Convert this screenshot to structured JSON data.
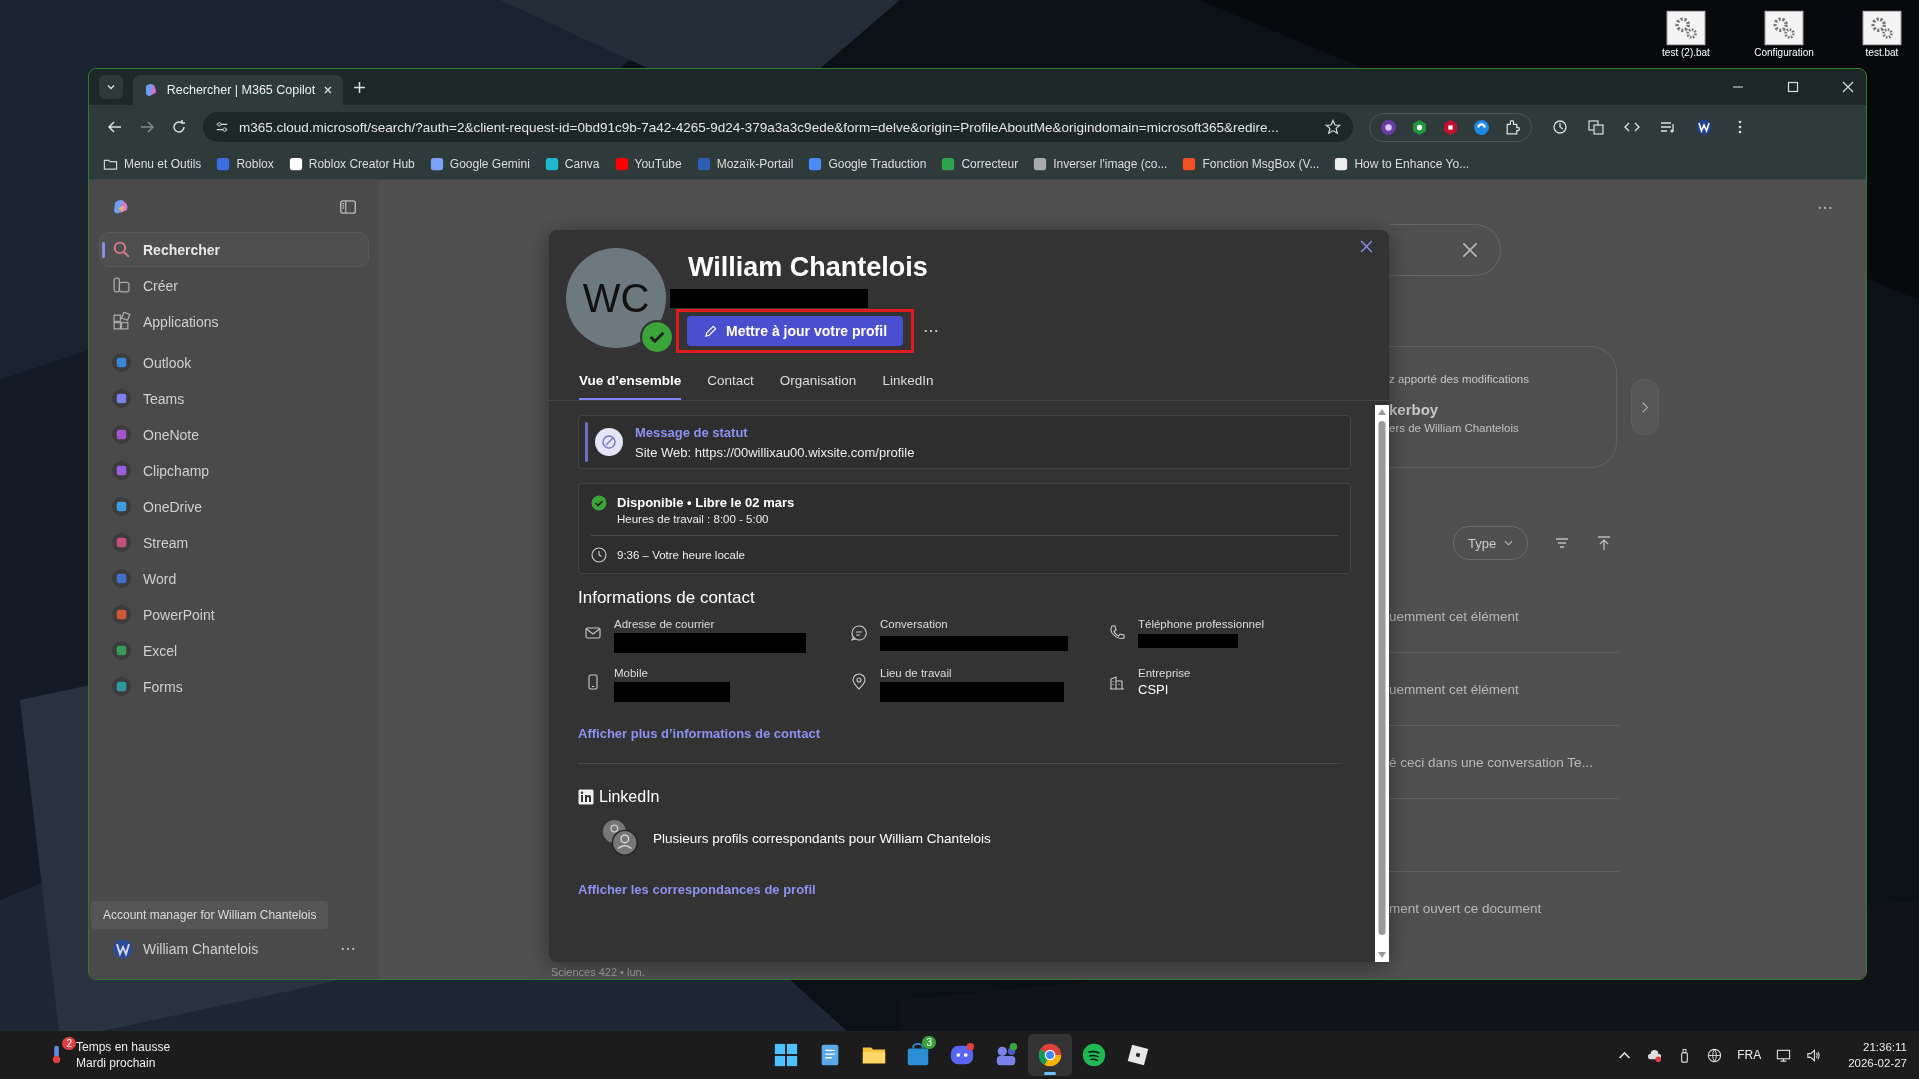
{
  "desktop_icons": [
    {
      "label": "test (2).bat"
    },
    {
      "label": "Configuration"
    },
    {
      "label": "test.bat"
    }
  ],
  "browser": {
    "tabs": [
      {
        "title": "Rechercher | M365 Copilot",
        "selected": true
      }
    ],
    "address": "m365.cloud.microsoft/search/?auth=2&client-request-id=0bd91c9b-7a42-4265-9d24-379a3a3c9ede&form=delve&origin=ProfileAboutMe&origindomain=microsoft365&redire...",
    "bookmarks": [
      {
        "label": "Menu et Outils",
        "color": "#cfcfcf"
      },
      {
        "label": "Roblox",
        "color": "#3b6fe0"
      },
      {
        "label": "Roblox Creator Hub",
        "color": "#ffffff"
      },
      {
        "label": "Google Gemini",
        "color": "#7aa2f7"
      },
      {
        "label": "Canva",
        "color": "#20b8d0"
      },
      {
        "label": "YouTube",
        "color": "#ff0000"
      },
      {
        "label": "Mozaïk-Portail",
        "color": "#2f5fb3"
      },
      {
        "label": "Google Traduction",
        "color": "#4a8af4"
      },
      {
        "label": "Correcteur",
        "color": "#2ea44f"
      },
      {
        "label": "Inverser l'image (co...",
        "color": "#aaaaaa"
      },
      {
        "label": "Fonction MsgBox (V...",
        "color": "#f25022"
      },
      {
        "label": "How to Enhance Yo...",
        "color": "#eeeeee"
      }
    ]
  },
  "sidebar": {
    "items": [
      {
        "label": "Rechercher",
        "kind": "search",
        "selected": true
      },
      {
        "label": "Créer",
        "kind": "create",
        "selected": false
      },
      {
        "label": "Applications",
        "kind": "apps",
        "selected": false
      },
      {
        "label": "Outlook",
        "kind": "app",
        "color": "#3a86d8",
        "selected": false
      },
      {
        "label": "Teams",
        "kind": "app",
        "color": "#7b83eb",
        "selected": false
      },
      {
        "label": "OneNote",
        "kind": "app",
        "color": "#a555c8",
        "selected": false
      },
      {
        "label": "Clipchamp",
        "kind": "app",
        "color": "#9b5fe0",
        "selected": false
      },
      {
        "label": "OneDrive",
        "kind": "app",
        "color": "#3d9be0",
        "selected": false
      },
      {
        "label": "Stream",
        "kind": "app",
        "color": "#c2507a",
        "selected": false
      },
      {
        "label": "Word",
        "kind": "app",
        "color": "#3f6fc8",
        "selected": false
      },
      {
        "label": "PowerPoint",
        "kind": "app",
        "color": "#d0563a",
        "selected": false
      },
      {
        "label": "Excel",
        "kind": "app",
        "color": "#3a9a5c",
        "selected": false
      },
      {
        "label": "Forms",
        "kind": "app",
        "color": "#2e9aa0",
        "selected": false
      }
    ],
    "tooltip": "Account manager for William Chantelois",
    "account": "William Chantelois"
  },
  "background": {
    "card": {
      "line_1": "z apporté des modifications",
      "title": "kerboy",
      "line_2": "ers de William Chantelois"
    },
    "filter": "Type",
    "rows": [
      "uemment cet élément",
      "uemment cet élément",
      "é ceci dans une conversation Te...",
      "",
      "ment ouvert ce document"
    ],
    "footer": "Sciences 422 • lun."
  },
  "profile": {
    "initials": "WC",
    "name": "William Chantelois",
    "available": true,
    "subtitle_redacted": true,
    "update_button": "Mettre à jour votre profil",
    "highlighted": true,
    "tabs": [
      {
        "label": "Vue d’ensemble",
        "selected": true
      },
      {
        "label": "Contact",
        "selected": false
      },
      {
        "label": "Organisation",
        "selected": false
      },
      {
        "label": "LinkedIn",
        "selected": false
      }
    ],
    "status": {
      "title": "Message de statut",
      "text": "Site Web: https://00willixau00.wixsite.com/profile"
    },
    "presence": {
      "title": "Disponible • Libre le 02 mars",
      "hours": "Heures de travail : 8:00 - 5:00",
      "local_time": "9:36 – Votre heure locale"
    },
    "contact": {
      "heading": "Informations de contact",
      "fields": [
        {
          "label": "Adresse de courrier",
          "kind": "mail",
          "redacted": true
        },
        {
          "label": "Conversation",
          "kind": "chat",
          "redacted": true
        },
        {
          "label": "Téléphone professionnel",
          "kind": "phone",
          "redacted": true
        },
        {
          "label": "Mobile",
          "kind": "mobile",
          "redacted": true
        },
        {
          "label": "Lieu de travail",
          "kind": "location",
          "redacted": true
        },
        {
          "label": "Entreprise",
          "kind": "company",
          "redacted": false,
          "value": "CSPI"
        }
      ],
      "more_link": "Afficher plus d’informations de contact"
    },
    "linkedin": {
      "heading": "LinkedIn",
      "text": "Plusieurs profils correspondants pour William Chantelois",
      "link": "Afficher les correspondances de profil"
    }
  },
  "taskbar": {
    "weather": {
      "badge": "2",
      "title": "Temps en hausse",
      "subtitle": "Mardi prochain"
    },
    "apps": [
      {
        "kind": "start",
        "selected": false
      },
      {
        "kind": "notepad",
        "selected": false
      },
      {
        "kind": "folder",
        "selected": false
      },
      {
        "kind": "store",
        "selected": false,
        "badge": "3"
      },
      {
        "kind": "discord",
        "selected": false
      },
      {
        "kind": "teams",
        "selected": false
      },
      {
        "kind": "chrome",
        "selected": true
      },
      {
        "kind": "spotify",
        "selected": false
      },
      {
        "kind": "roblox",
        "selected": false
      }
    ],
    "language": "FRA",
    "time": "21:36:11",
    "date": "2026-02-27"
  }
}
